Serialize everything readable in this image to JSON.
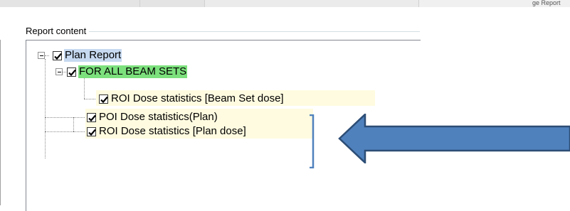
{
  "window": {
    "topbar_trailing_text": "ge Report"
  },
  "report_content": {
    "group_title": "Report content",
    "tree": {
      "root": {
        "label": "Plan Report",
        "checked": true,
        "highlight": "#c6d9f0"
      },
      "beam_sets": {
        "label": "FOR ALL BEAM SETS",
        "checked": true,
        "highlight": "#7ce07c"
      },
      "roi_beam_set": {
        "label": "ROI Dose statistics [Beam Set dose]",
        "checked": true
      },
      "poi_plan": {
        "label": "POI Dose statistics(Plan)",
        "checked": true
      },
      "roi_plan": {
        "label": "ROI Dose statistics [Plan dose]",
        "checked": true
      }
    }
  },
  "annotation": {
    "arrow_color": "#4f81bd",
    "arrow_outline": "#2c4d75",
    "bracket_color": "#4f81bd"
  }
}
